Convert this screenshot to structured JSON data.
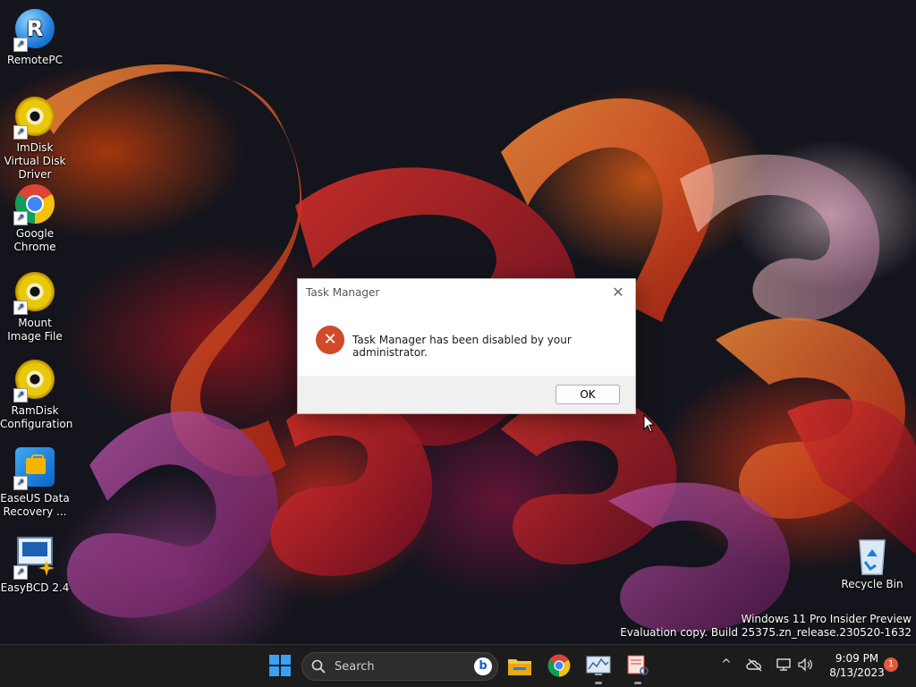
{
  "desktop": {
    "icons": [
      {
        "label": "RemotePC",
        "icon": "remotepc-icon"
      },
      {
        "label": "ImDisk Virtual Disk Driver",
        "icon": "disc-icon"
      },
      {
        "label": "Google Chrome",
        "icon": "chrome-icon"
      },
      {
        "label": "Mount Image File",
        "icon": "disc-icon"
      },
      {
        "label": "RamDisk Configuration",
        "icon": "disc-icon"
      },
      {
        "label": "EaseUS Data Recovery ...",
        "icon": "easeus-icon"
      },
      {
        "label": "EasyBCD 2.4",
        "icon": "easybcd-icon"
      }
    ],
    "recycle_bin": {
      "label": "Recycle Bin",
      "icon": "recycle-bin-icon"
    },
    "watermark": {
      "line1": "Windows 11 Pro Insider Preview",
      "line2": "Evaluation copy. Build 25375.zn_release.230520-1632"
    }
  },
  "dialog": {
    "title": "Task Manager",
    "message": "Task Manager has been disabled by your administrator.",
    "ok_label": "OK",
    "close_glyph": "✕",
    "icon": "error-icon"
  },
  "taskbar": {
    "search_placeholder": "Search",
    "apps": [
      "windows-start-icon",
      "search",
      "file-explorer-icon",
      "chrome-icon",
      "resource-monitor-icon",
      "snipping-tool-icon"
    ],
    "clock": {
      "time": "9:09 PM",
      "date": "8/13/2023"
    },
    "notification_count": "1"
  },
  "colors": {
    "accent_blue": "#0078d4",
    "error_red": "#d14a2a",
    "taskbar_bg": "#1c1c1c"
  }
}
